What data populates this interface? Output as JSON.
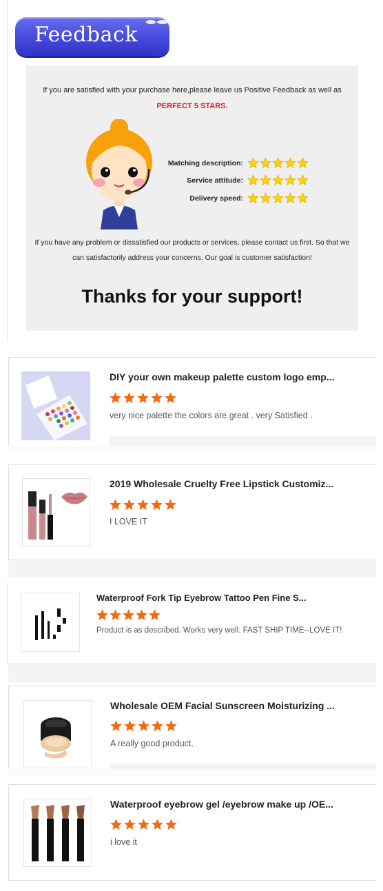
{
  "badge": {
    "label": "Feedback"
  },
  "banner": {
    "intro": "If you are satisfied with your purchase here,please leave us Positive Feedback as well as",
    "intro_highlight": "PERFECT 5 STARS.",
    "ratings": [
      {
        "label": "Matching description:",
        "stars": 5
      },
      {
        "label": "Service attitude:",
        "stars": 5
      },
      {
        "label": "Delivery speed:",
        "stars": 5
      }
    ],
    "contact_line1": "If you have any problem or dissatisfied our products or services, please contact us first. So that we",
    "contact_line2": "can satisfactorily address your concerns. Our goal is customer satisfaction!",
    "thanks": "Thanks for your support!"
  },
  "reviews": [
    {
      "title": "DIY your own makeup palette custom logo emp...",
      "stars": 5,
      "review": "very nice palette the colors are great  . very Satisfied ."
    },
    {
      "title": "2019 Wholesale Cruelty Free Lipstick Customiz...",
      "stars": 5,
      "review": "I LOVE IT"
    },
    {
      "title": "Waterproof Fork Tip Eyebrow Tattoo Pen Fine S...",
      "stars": 5,
      "review": "Product is as described. Works very well. FAST SHIP TIME--LOVE IT!"
    },
    {
      "title": "Wholesale OEM Facial Sunscreen Moisturizing ...",
      "stars": 5,
      "review": "A really good product."
    },
    {
      "title": "Waterproof eyebrow gel /eyebrow make up /OE...",
      "stars": 5,
      "review": "i love it"
    }
  ],
  "colors": {
    "badge": "#4a4fe0",
    "highlight": "#e0161e",
    "star_yellow": "#ffd200",
    "star_orange": "#f26a10"
  },
  "icons": {
    "rating_star": "yellow-star-icon",
    "review_star": "orange-star-icon"
  }
}
